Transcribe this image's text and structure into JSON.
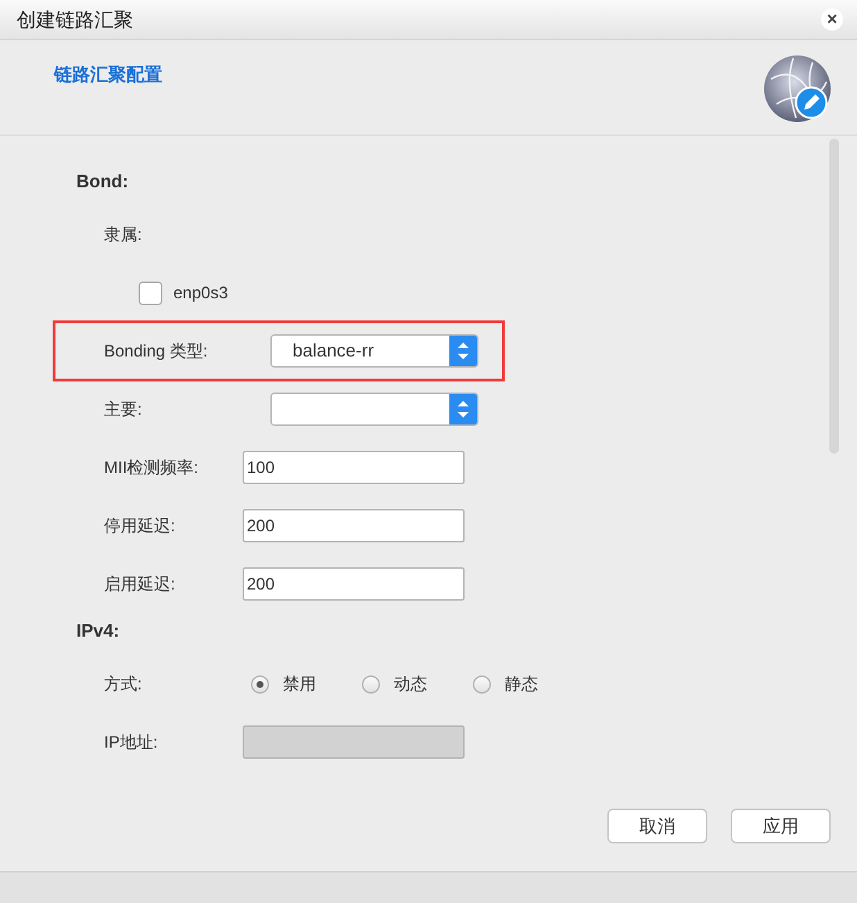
{
  "window": {
    "title": "创建链路汇聚",
    "close": "×"
  },
  "header": {
    "title": "链路汇聚配置"
  },
  "sections": [
    {
      "title": "Bond:",
      "rows": [
        {
          "kind": "label",
          "label": "隶属:"
        },
        {
          "kind": "checkbox",
          "label": "enp0s3",
          "checked": false
        },
        {
          "kind": "select",
          "label": "Bonding 类型:",
          "value": "balance-rr",
          "highlighted": true
        },
        {
          "kind": "select",
          "label": "主要:",
          "highlighted": false
        },
        {
          "kind": "text",
          "label": "MII检测频率:",
          "value": "100",
          "disabled": false
        },
        {
          "kind": "text",
          "label": "停用延迟:",
          "value": "200",
          "disabled": false
        },
        {
          "kind": "text",
          "label": "启用延迟:",
          "value": "200",
          "disabled": false
        }
      ]
    },
    {
      "title": "IPv4:",
      "rows": [
        {
          "kind": "radio",
          "label": "方式:",
          "options": [
            {
              "label": "禁用",
              "selected": true
            },
            {
              "label": "动态",
              "selected": false
            },
            {
              "label": "静态",
              "selected": false
            }
          ]
        },
        {
          "kind": "text",
          "label": "IP地址:",
          "disabled": true
        }
      ]
    }
  ],
  "buttons": [
    "取消",
    "应用"
  ]
}
